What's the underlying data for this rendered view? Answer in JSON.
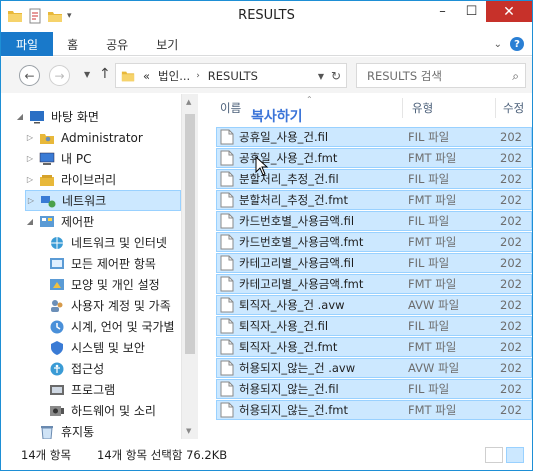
{
  "window": {
    "title": "RESULTS"
  },
  "ribbon": {
    "tabs": [
      "파일",
      "홈",
      "공유",
      "보기"
    ]
  },
  "address": {
    "overflow": "«",
    "crumbs": [
      "법인...",
      "RESULTS"
    ],
    "search_placeholder": "RESULTS 검색"
  },
  "nav": {
    "items": [
      {
        "label": "바탕 화면",
        "icon": "desktop-icon",
        "level": 0
      },
      {
        "label": "Administrator",
        "icon": "user-folder-icon",
        "level": 1
      },
      {
        "label": "내 PC",
        "icon": "computer-icon",
        "level": 1
      },
      {
        "label": "라이브러리",
        "icon": "library-icon",
        "level": 1
      },
      {
        "label": "네트워크",
        "icon": "network-icon",
        "level": 1
      },
      {
        "label": "제어판",
        "icon": "control-panel-icon",
        "level": 1
      },
      {
        "label": "네트워크 및 인터넷",
        "icon": "network-internet-icon",
        "level": 2
      },
      {
        "label": "모든 제어판 항목",
        "icon": "control-panel-items-icon",
        "level": 2
      },
      {
        "label": "모양 및 개인 설정",
        "icon": "personalization-icon",
        "level": 2
      },
      {
        "label": "사용자 계정 및 가족",
        "icon": "user-accounts-icon",
        "level": 2
      },
      {
        "label": "시계, 언어 및 국가별",
        "icon": "clock-language-icon",
        "level": 2
      },
      {
        "label": "시스템 및 보안",
        "icon": "system-security-icon",
        "level": 2
      },
      {
        "label": "접근성",
        "icon": "accessibility-icon",
        "level": 2
      },
      {
        "label": "프로그램",
        "icon": "programs-icon",
        "level": 2
      },
      {
        "label": "하드웨어 및 소리",
        "icon": "hardware-sound-icon",
        "level": 2
      },
      {
        "label": "휴지통",
        "icon": "recycle-bin-icon",
        "level": 1
      }
    ]
  },
  "list": {
    "columns": {
      "name": "이름",
      "type": "유형",
      "date": "수정"
    },
    "overlay_text": "복사하기",
    "rows": [
      {
        "name": "공휴일_사용_건.fil",
        "type": "FIL 파일",
        "date": "202"
      },
      {
        "name": "공휴일_사용_건.fmt",
        "type": "FMT 파일",
        "date": "202"
      },
      {
        "name": "분할처리_추정_건.fil",
        "type": "FIL 파일",
        "date": "202"
      },
      {
        "name": "분할처리_추정_건.fmt",
        "type": "FMT 파일",
        "date": "202"
      },
      {
        "name": "카드번호별_사용금액.fil",
        "type": "FIL 파일",
        "date": "202"
      },
      {
        "name": "카드번호별_사용금액.fmt",
        "type": "FMT 파일",
        "date": "202"
      },
      {
        "name": "카테고리별_사용금액.fil",
        "type": "FIL 파일",
        "date": "202"
      },
      {
        "name": "카테고리별_사용금액.fmt",
        "type": "FMT 파일",
        "date": "202"
      },
      {
        "name": "퇴직자_사용_건 .avw",
        "type": "AVW 파일",
        "date": "202"
      },
      {
        "name": "퇴직자_사용_건.fil",
        "type": "FIL 파일",
        "date": "202"
      },
      {
        "name": "퇴직자_사용_건.fmt",
        "type": "FMT 파일",
        "date": "202"
      },
      {
        "name": "허용되지_않는_건 .avw",
        "type": "AVW 파일",
        "date": "202"
      },
      {
        "name": "허용되지_않는_건.fil",
        "type": "FIL 파일",
        "date": "202"
      },
      {
        "name": "허용되지_않는_건.fmt",
        "type": "FMT 파일",
        "date": "202"
      }
    ]
  },
  "status": {
    "count": "14개 항목",
    "selection": "14개 항목 선택함 76.2KB"
  },
  "colors": {
    "accent": "#1979ca",
    "selection": "#cce8ff",
    "selection_border": "#99d1ff",
    "close": "#c7312a"
  }
}
